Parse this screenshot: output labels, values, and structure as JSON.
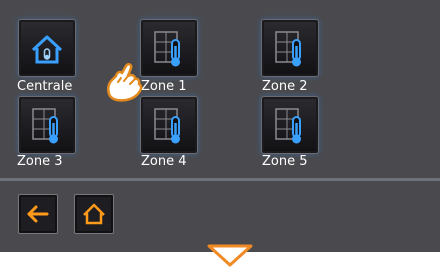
{
  "tiles": [
    {
      "label": "Centrale",
      "icon": "home-icon"
    },
    {
      "label": "Zone 1",
      "icon": "thermostat-window-icon"
    },
    {
      "label": "Zone 2",
      "icon": "thermostat-window-icon"
    },
    {
      "label": "Zone 3",
      "icon": "thermostat-window-icon"
    },
    {
      "label": "Zone 4",
      "icon": "thermostat-window-icon"
    },
    {
      "label": "Zone 5",
      "icon": "thermostat-window-icon"
    }
  ],
  "bottom_bar": {
    "back_icon": "arrow-left-icon",
    "home_icon": "home-outline-icon",
    "accent_color": "#ff9a1a"
  },
  "overlay": {
    "pointer_icon": "hand-pointer-icon",
    "indicator_icon": "triangle-down-icon"
  },
  "colors": {
    "panel": "#4a4a4e",
    "icon_blue": "#3aa0ff",
    "label": "#ffffff"
  }
}
